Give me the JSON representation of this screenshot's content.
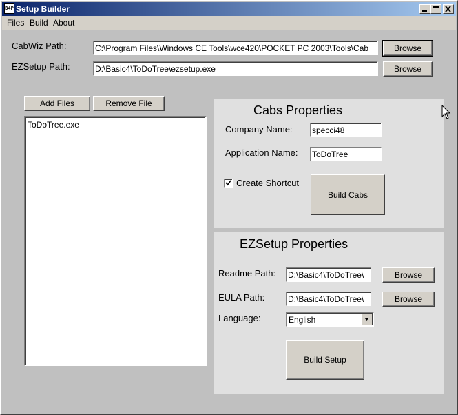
{
  "window": {
    "title": "Setup Builder",
    "icon_text": "B4P"
  },
  "menu": [
    "Files",
    "Build",
    "About"
  ],
  "paths": {
    "cabwiz_label": "CabWiz Path:",
    "cabwiz_value": "C:\\Program Files\\Windows CE Tools\\wce420\\POCKET PC 2003\\Tools\\Cab",
    "ezsetup_label": "EZSetup Path:",
    "ezsetup_value": "D:\\Basic4\\ToDoTree\\ezsetup.exe",
    "browse_label": "Browse"
  },
  "files": {
    "add_label": "Add Files",
    "remove_label": "Remove File",
    "items": [
      "ToDoTree.exe"
    ]
  },
  "cabs": {
    "title": "Cabs Properties",
    "company_label": "Company Name:",
    "company_value": "specci48",
    "app_label": "Application Name:",
    "app_value": "ToDoTree",
    "shortcut_label": "Create Shortcut",
    "shortcut_checked": true,
    "build_label": "Build Cabs"
  },
  "ezsetup": {
    "title": "EZSetup Properties",
    "readme_label": "Readme Path:",
    "readme_value": "D:\\Basic4\\ToDoTree\\",
    "eula_label": "EULA Path:",
    "eula_value": "D:\\Basic4\\ToDoTree\\",
    "language_label": "Language:",
    "language_value": "English",
    "browse_label": "Browse",
    "build_label": "Build Setup"
  }
}
